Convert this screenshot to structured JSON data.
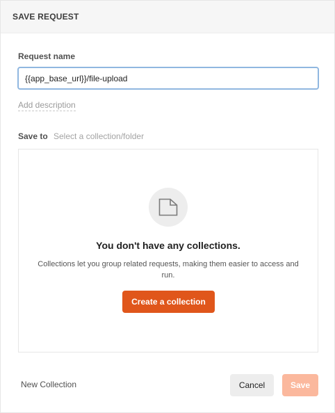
{
  "dialog": {
    "title": "SAVE REQUEST"
  },
  "request_name": {
    "label": "Request name",
    "value": "{{app_base_url}}/file-upload"
  },
  "add_description": {
    "label": "Add description"
  },
  "save_to": {
    "label": "Save to",
    "placeholder": "Select a collection/folder"
  },
  "empty_state": {
    "icon": "folder-icon",
    "title": "You don't have any collections.",
    "description": "Collections let you group related requests, making them easier to access and run.",
    "create_button_label": "Create a collection"
  },
  "footer": {
    "new_collection_label": "New Collection",
    "cancel_label": "Cancel",
    "save_label": "Save"
  },
  "colors": {
    "accent": "#e0561b",
    "accent_disabled": "#fbb89d",
    "focus_border": "#90b7e0"
  }
}
